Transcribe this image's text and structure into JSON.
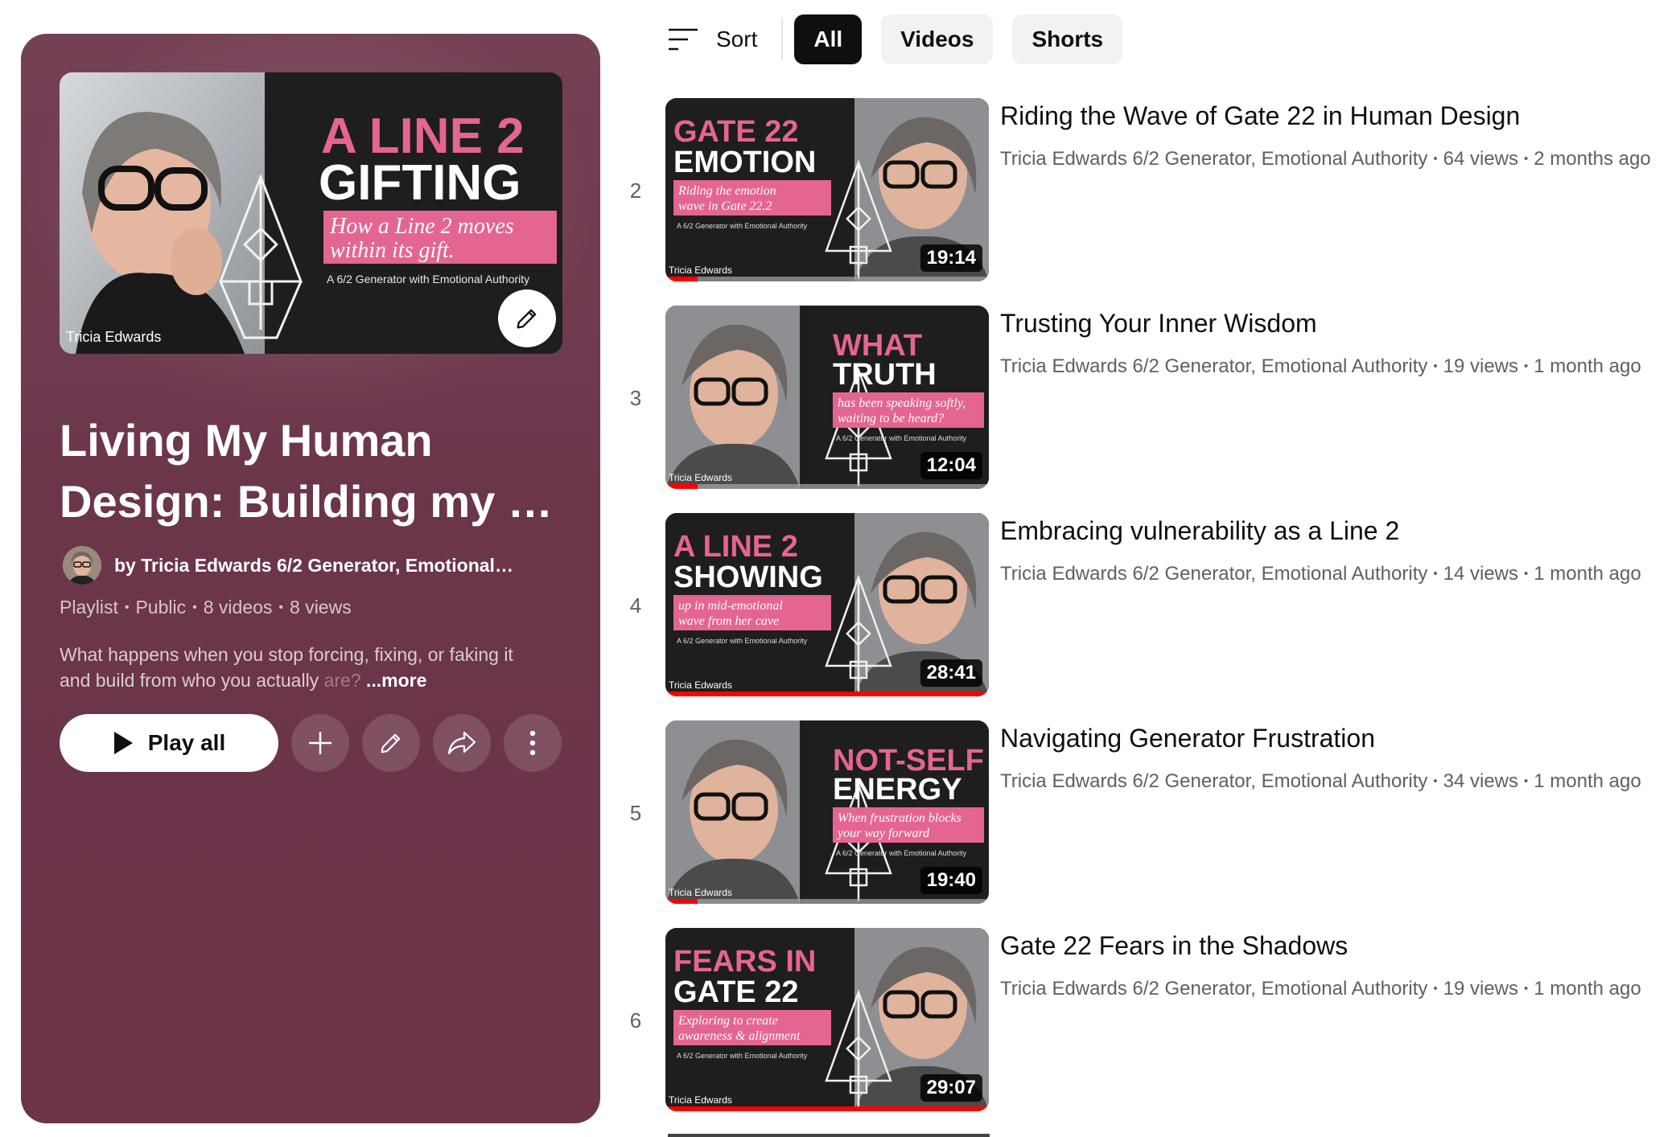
{
  "chips": {
    "sort_label": "Sort",
    "items": [
      "All",
      "Videos",
      "Shorts"
    ],
    "active": "All"
  },
  "playlist": {
    "thumbnail": {
      "headline1": "A LINE 2",
      "headline2": "GIFTING",
      "tagline1": "How a Line 2 moves",
      "tagline2": "within its gift.",
      "subline": "A 6/2 Generator with Emotional Authority",
      "watermark": "Tricia Edwards"
    },
    "title_line1": "Living My Human",
    "title_line2": "Design: Building my …",
    "owner": "by Tricia Edwards 6/2 Generator, Emotional…",
    "meta": [
      "Playlist",
      "Public",
      "8 videos",
      "8 views"
    ],
    "description_line1": "What happens when you stop forcing, fixing, or faking it",
    "description_line2": "and build from who you actually ",
    "description_fade": "are?",
    "more_label": "...more",
    "play_all_label": "Play all"
  },
  "videos": [
    {
      "index": "2",
      "title": "Riding the Wave of Gate 22 in Human Design",
      "channel": "Tricia Edwards 6/2 Generator, Emotional Authority",
      "views": "64 views",
      "age": "2 months ago",
      "duration": "19:14",
      "progress": 0.1,
      "thumb_line1": "GATE 22",
      "thumb_line2": "EMOTION",
      "thumb_tag1": "Riding the emotion",
      "thumb_tag2": "wave in Gate 22.2",
      "thumb_sub": "A 6/2 Generator with Emotional Authority",
      "thumb_layout": "text-left",
      "accent": "#e46591"
    },
    {
      "index": "3",
      "title": "Trusting Your Inner Wisdom",
      "channel": "Tricia Edwards 6/2 Generator, Emotional Authority",
      "views": "19 views",
      "age": "1 month ago",
      "duration": "12:04",
      "progress": 0.1,
      "thumb_line1": "WHAT",
      "thumb_line2": "TRUTH",
      "thumb_tag1": "has been speaking softly,",
      "thumb_tag2": "waiting to be heard?",
      "thumb_sub": "A 6/2 Generator with Emotional Authority",
      "thumb_layout": "text-right",
      "accent": "#e46591"
    },
    {
      "index": "4",
      "title": "Embracing vulnerability as a Line 2",
      "channel": "Tricia Edwards 6/2 Generator, Emotional Authority",
      "views": "14 views",
      "age": "1 month ago",
      "duration": "28:41",
      "progress": 1.0,
      "thumb_line1": "A LINE 2",
      "thumb_line2": "SHOWING",
      "thumb_tag1": "up in mid-emotional",
      "thumb_tag2": "wave from her cave",
      "thumb_sub": "A 6/2 Generator with Emotional Authority",
      "thumb_layout": "text-left",
      "accent": "#e46591"
    },
    {
      "index": "5",
      "title": "Navigating Generator Frustration",
      "channel": "Tricia Edwards 6/2 Generator, Emotional Authority",
      "views": "34 views",
      "age": "1 month ago",
      "duration": "19:40",
      "progress": 0.1,
      "thumb_line1": "NOT-SELF",
      "thumb_line2": "ENERGY",
      "thumb_tag1": "When frustration blocks",
      "thumb_tag2": "your way forward",
      "thumb_sub": "A 6/2 Generator with Emotional Authority",
      "thumb_layout": "text-right",
      "accent": "#e46591"
    },
    {
      "index": "6",
      "title": "Gate 22 Fears in the Shadows",
      "channel": "Tricia Edwards 6/2 Generator, Emotional Authority",
      "views": "19 views",
      "age": "1 month ago",
      "duration": "29:07",
      "progress": 1.0,
      "thumb_line1": "FEARS IN",
      "thumb_line2": "GATE 22",
      "thumb_tag1": "Exploring to create",
      "thumb_tag2": "awareness & alignment",
      "thumb_sub": "A 6/2 Generator with Emotional Authority",
      "thumb_layout": "text-left",
      "accent": "#e46591"
    }
  ],
  "watermark_small": "Tricia Edwards"
}
